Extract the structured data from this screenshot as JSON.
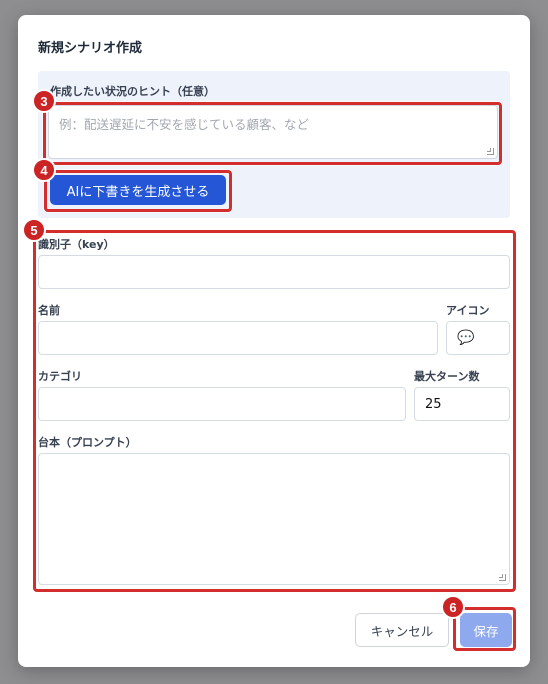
{
  "dialog": {
    "title": "新規シナリオ作成"
  },
  "hint": {
    "label": "作成したい状況のヒント（任意）",
    "placeholder": "例：配送遅延に不安を感じている顧客、など",
    "value": ""
  },
  "ai_button": {
    "label": "AIに下書きを生成させる"
  },
  "fields": {
    "key_label": "識別子（key）",
    "key_value": "",
    "name_label": "名前",
    "name_value": "",
    "icon_label": "アイコン",
    "icon_value": "💬",
    "category_label": "カテゴリ",
    "category_value": "",
    "max_turns_label": "最大ターン数",
    "max_turns_value": "25",
    "script_label": "台本（プロンプト）",
    "script_value": ""
  },
  "footer": {
    "cancel_label": "キャンセル",
    "save_label": "保存"
  },
  "annotations": {
    "badge_3": "3",
    "badge_4": "4",
    "badge_5": "5",
    "badge_6": "6",
    "highlight_color": "#d32d2d"
  },
  "colors": {
    "accent": "#2456d6",
    "save_disabled": "#8ea9ee",
    "panel_bg": "#eef2fb"
  }
}
